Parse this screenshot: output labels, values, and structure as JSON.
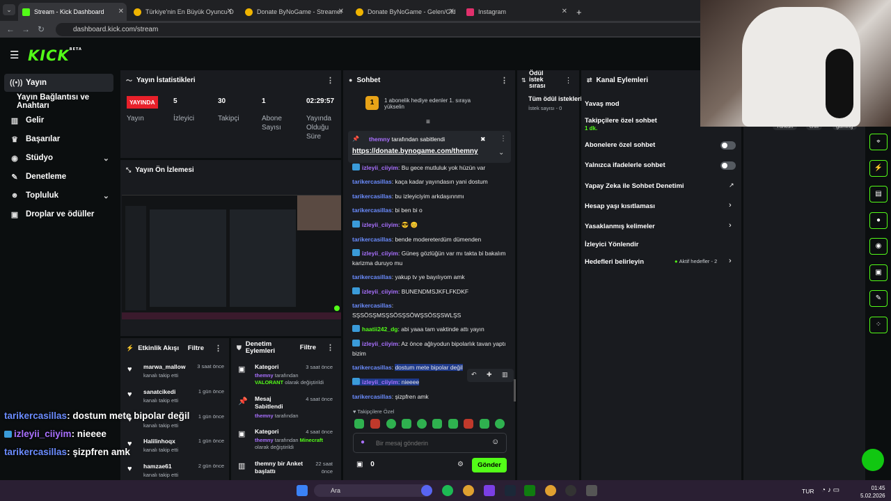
{
  "browser": {
    "tabs": [
      {
        "label": "Stream - Kick Dashboard",
        "color": "#53fc18"
      },
      {
        "label": "Türkiye'nin En Büyük Oyuncu D",
        "color": "#f0b400"
      },
      {
        "label": "Donate ByNoGame - Streamer",
        "color": "#f0b400"
      },
      {
        "label": "Donate ByNoGame - Gelen/Gid",
        "color": "#f0b400"
      },
      {
        "label": "Instagram",
        "color": "#e1306c"
      }
    ],
    "new_tab": "+",
    "url": "dashboard.kick.com/stream"
  },
  "logo": {
    "text": "KICK",
    "beta": "BETA"
  },
  "sidebar": {
    "items": [
      {
        "label": "Yayın",
        "icon": "live-icon"
      },
      {
        "label": "Yayın Bağlantısı ve Anahtarı",
        "icon": ""
      },
      {
        "label": "Gelir",
        "icon": "chart-icon"
      },
      {
        "label": "Başarılar",
        "icon": "trophy-icon"
      },
      {
        "label": "Stüdyo",
        "icon": "studio-icon"
      },
      {
        "label": "Denetleme",
        "icon": "wrench-icon"
      },
      {
        "label": "Topluluk",
        "icon": "community-icon"
      },
      {
        "label": "Droplar ve ödüller",
        "icon": "gift-icon"
      }
    ]
  },
  "stats": {
    "title": "Yayın İstatistikleri",
    "live": "YAYINDA",
    "live_label": "Yayın",
    "items": [
      {
        "value": "5",
        "label": "İzleyici"
      },
      {
        "value": "30",
        "label": "Takipçi"
      },
      {
        "value": "1",
        "label": "Abone Sayısı"
      },
      {
        "value": "02:29:57",
        "label": "Yayında Olduğu Süre"
      }
    ]
  },
  "preview": {
    "title": "Yayın Ön İzlemesi"
  },
  "feed": {
    "title": "Etkinlik Akışı",
    "filter": "Filtre",
    "rows": [
      {
        "name": "marwa_mallow",
        "sub": "kanalı takip etti",
        "time": "3 saat önce"
      },
      {
        "name": "sanatcikedi",
        "sub": "kanalı takip etti",
        "time": "1 gün önce"
      },
      {
        "name": "",
        "sub": "kanalı takip etti",
        "time": "1 gün önce"
      },
      {
        "name": "Halilinhoqx",
        "sub": "kanalı takip etti",
        "time": "1 gün önce"
      },
      {
        "name": "hamzae61",
        "sub": "kanalı takip etti",
        "time": "2 gün önce"
      }
    ]
  },
  "moderation": {
    "title": "Denetim Eylemleri",
    "filter": "Filtre",
    "rows": [
      {
        "title": "Kategori",
        "time": "3 saat önce",
        "user": "themny",
        "mid": "tarafından",
        "highlight": "VALORANT",
        "rest": "olarak değiştirildi"
      },
      {
        "title": "Mesaj Sabitlendi",
        "time": "4 saat önce",
        "user": "themny",
        "mid": "tarafından",
        "highlight": "",
        "rest": ""
      },
      {
        "title": "Kategori",
        "time": "4 saat önce",
        "user": "themny",
        "mid": "tarafından",
        "highlight": "Minecraft",
        "rest": "olarak değiştirildi"
      },
      {
        "title": "themny bir Anket başlattı",
        "time": "22 saat önce",
        "user": "",
        "mid": "",
        "highlight": "",
        "rest": ""
      }
    ]
  },
  "chat": {
    "title": "Sohbet",
    "gift_banner": "1 abonelik hediye edenler 1. sıraya yükselin",
    "gift_rank": "1",
    "pinned_by_user": "themny",
    "pinned_by_text": "tarafından sabitlendi",
    "pinned_link": "https://donate.bynogame.com/themny",
    "messages": [
      {
        "user": "izleyii_ciiyim",
        "cls": "u2",
        "badge": true,
        "text": "Bu gece mutluluk yok hüzün var"
      },
      {
        "user": "tarikercasillas",
        "cls": "u1",
        "badge": false,
        "text": "kaça kadar yayındasın yani dostum"
      },
      {
        "user": "tarikercasillas",
        "cls": "u1",
        "badge": false,
        "text": "bu izleyiciyim arkdaşınnmı"
      },
      {
        "user": "tarikercasillas",
        "cls": "u1",
        "badge": false,
        "text": "bi ben bi o"
      },
      {
        "user": "izleyii_ciiyim",
        "cls": "u2",
        "badge": true,
        "text": "😎 😊"
      },
      {
        "user": "tarikercasillas",
        "cls": "u1",
        "badge": false,
        "text": "bende modereterdüm dümenden"
      },
      {
        "user": "izleyii_ciiyim",
        "cls": "u2",
        "badge": true,
        "text": "Güneş gözlüğün var mı takta bi bakalım karizma duruyo mu"
      },
      {
        "user": "tarikercasillas",
        "cls": "u1",
        "badge": false,
        "text": "yakup tv ye bayılıyom amk"
      },
      {
        "user": "izleyii_ciiyim",
        "cls": "u2",
        "badge": true,
        "text": "BUNENDMSJKFLFKDKF"
      },
      {
        "user": "tarikercasillas",
        "cls": "u1",
        "badge": false,
        "text": "SŞSÖSŞMSŞSÖSŞSÖWŞSÖSŞSWLŞS"
      },
      {
        "user": "haatii242_dg",
        "cls": "u3",
        "badge": true,
        "text": "abi yaaa tam vaktinde attı yayın"
      },
      {
        "user": "izleyii_ciiyim",
        "cls": "u2",
        "badge": true,
        "text": "Az önce ağlıyodun bipolarlık tavan yaptı bizim"
      },
      {
        "user": "tarikercasillas",
        "cls": "u1",
        "badge": false,
        "text": "dostum mete bipolar değil"
      },
      {
        "user": "izleyii_ciiyim",
        "cls": "u2",
        "badge": true,
        "text": "nieeee"
      },
      {
        "user": "tarikercasillas",
        "cls": "u1",
        "badge": false,
        "text": "şizpfren amk"
      }
    ],
    "followers_only": "Takipçilere Özel",
    "input_placeholder": "Bir mesaj gönderin",
    "points": "0",
    "send": "Gönder"
  },
  "rewards": {
    "title": "Ödül istek sırası",
    "all": "Tüm ödül istekleri",
    "count": "İstek sayısı - 0"
  },
  "actions": {
    "title": "Kanal Eylemleri",
    "items": [
      {
        "label": "Yavaş mod",
        "type": "none",
        "extra": ""
      },
      {
        "label": "Takipçilere özel sohbet",
        "type": "none",
        "extra": "1 dk."
      },
      {
        "label": "Abonelere özel sohbet",
        "type": "toggle",
        "extra": ""
      },
      {
        "label": "Yalnızca ifadelerle sohbet",
        "type": "toggle",
        "extra": ""
      },
      {
        "label": "Yapay Zeka ile Sohbet Denetimi",
        "type": "external",
        "extra": ""
      },
      {
        "label": "Hesap yaşı kısıtlaması",
        "type": "arrow",
        "extra": ""
      },
      {
        "label": "Yasaklanmış kelimeler",
        "type": "arrow",
        "extra": ""
      },
      {
        "label": "İzleyici Yönlendir",
        "type": "none",
        "extra": ""
      },
      {
        "label": "Hedefleri belirleyin",
        "type": "arrow",
        "extra": "Aktif hedefler - 2"
      }
    ]
  },
  "tags": [
    "Türkish",
    "chill",
    "gaming"
  ],
  "overlay": [
    {
      "user": "tarikercasillas",
      "text": ": dostum mete bipolar değil",
      "color": "#6b8cff"
    },
    {
      "user": "izleyii_ciiyim",
      "text": ": nieeee",
      "color": "#a970ff"
    },
    {
      "user": "tarikercasillas",
      "text": ": şizpfren amk",
      "color": "#6b8cff"
    }
  ],
  "taskbar": {
    "search": "Ara",
    "lang": "TUR",
    "time": "01:45",
    "date": "5.02.2026"
  }
}
